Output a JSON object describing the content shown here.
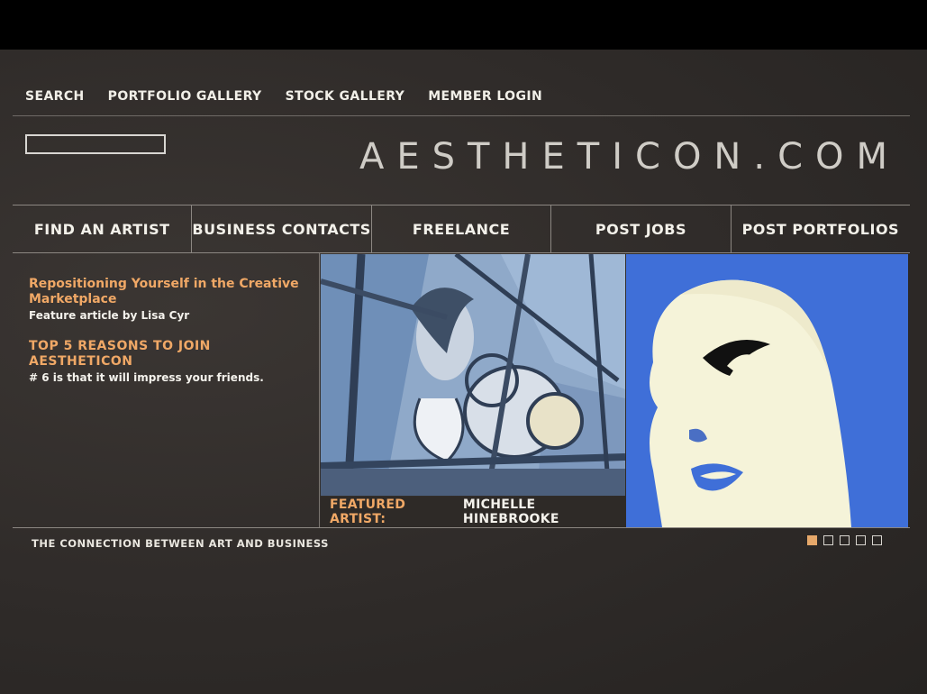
{
  "top_nav": [
    "SEARCH",
    "PORTFOLIO GALLERY",
    "STOCK GALLERY",
    "MEMBER LOGIN"
  ],
  "search": {
    "value": "",
    "placeholder": ""
  },
  "logo": "AESTHETICON.COM",
  "main_nav": [
    "FIND AN ARTIST",
    "BUSINESS CONTACTS",
    "FREELANCE",
    "POST JOBS",
    "POST PORTFOLIOS"
  ],
  "promo1": {
    "title": "Repositioning Yourself in the Creative Marketplace",
    "byline": "Feature article by Lisa Cyr"
  },
  "promo2": {
    "title": "TOP 5 REASONS TO JOIN AESTHETICON",
    "text": "# 6 is that it will impress your friends."
  },
  "featured": {
    "label": "FEATURED ARTIST:",
    "name": "MICHELLE HINEBROOKE"
  },
  "tagline": "THE CONNECTION BETWEEN ART AND BUSINESS",
  "pager": {
    "total": 5,
    "active": 1
  },
  "colors": {
    "accent": "#f0a866",
    "text": "#f1efe8",
    "hero_blue": "#3f6fd8",
    "background": "#2f2b29"
  },
  "icons": {
    "hero_left": "stained-glass-portrait-artwork",
    "hero_right": "pop-art-face-artwork"
  }
}
